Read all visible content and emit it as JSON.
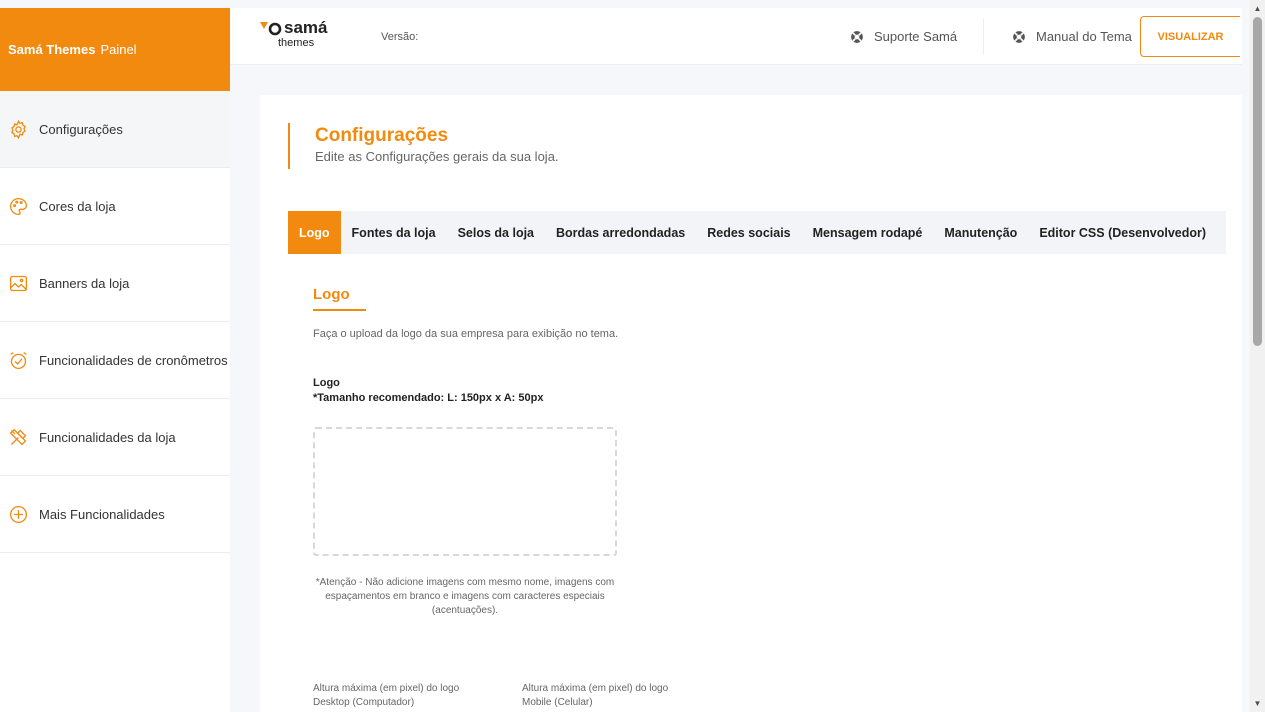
{
  "brand": {
    "name": "Samá Themes",
    "suffix": "Painel"
  },
  "sidebar": {
    "items": [
      {
        "label": "Configurações",
        "icon": "gear-icon"
      },
      {
        "label": "Cores da loja",
        "icon": "palette-icon"
      },
      {
        "label": "Banners da loja",
        "icon": "image-icon"
      },
      {
        "label": "Funcionalidades de cronômetros",
        "icon": "alarm-clock-icon"
      },
      {
        "label": "Funcionalidades da loja",
        "icon": "tools-icon"
      },
      {
        "label": "Mais Funcionalidades",
        "icon": "plus-circle-icon"
      }
    ]
  },
  "topbar": {
    "logo_top": "samá",
    "logo_bottom": "themes",
    "version_label": "Versão:",
    "support_label": "Suporte Samá",
    "manual_label": "Manual do Tema",
    "view_button": "VISUALIZAR"
  },
  "page": {
    "title": "Configurações",
    "subtitle": "Edite as Configurações gerais da sua loja."
  },
  "tabs": [
    "Logo",
    "Fontes da loja",
    "Selos da loja",
    "Bordas arredondadas",
    "Redes sociais",
    "Mensagem rodapé",
    "Manutenção",
    "Editor CSS (Desenvolvedor)"
  ],
  "section": {
    "title": "Logo",
    "description": "Faça o upload da logo da sua empresa para exibição no tema.",
    "field_label": "Logo",
    "field_hint": "*Tamanho recomendado: L: 150px x A: 50px",
    "warning": "*Atenção - Não adicione imagens com mesmo nome, imagens com espaçamentos em branco e imagens com caracteres especiais (acentuações).",
    "desktop_label_1": "Altura máxima (em pixel) do logo",
    "desktop_label_2": "Desktop (Computador)",
    "mobile_label_1": "Altura máxima (em pixel) do logo",
    "mobile_label_2": "Mobile (Celular)"
  },
  "colors": {
    "accent": "#f28a0f"
  }
}
